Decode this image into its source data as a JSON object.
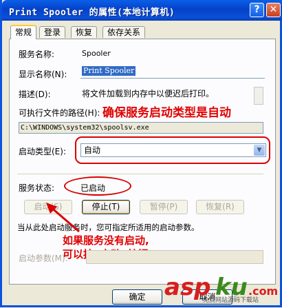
{
  "window": {
    "title": "Print Spooler 的属性(本地计算机)",
    "help_label": "?",
    "close_label": "✕"
  },
  "tabs": [
    "常规",
    "登录",
    "恢复",
    "依存关系"
  ],
  "fields": {
    "service_name_label": "服务名称:",
    "service_name_value": "Spooler",
    "display_name_label": "显示名称(N):",
    "display_name_value": "Print Spooler",
    "description_label": "描述(D):",
    "description_value": "将文件加载到内存中以便迟后打印。",
    "exe_path_label": "可执行文件的路径(H):",
    "exe_path_value": "C:\\WINDOWS\\system32\\spoolsv.exe",
    "startup_type_label": "启动类型(E):",
    "startup_type_value": "自动",
    "status_label": "服务状态:",
    "status_value": "已启动"
  },
  "buttons": {
    "start": "启动(S)",
    "stop": "停止(T)",
    "pause": "暂停(P)",
    "resume": "恢复(R)"
  },
  "info_text": "当从此处启动服务时，您可指定所适用的启动参数。",
  "params_label": "启动参数(M):",
  "params_value": "",
  "annotations": {
    "startup_note": "确保服务启动类型是自动",
    "start_note_line1": "如果服务没有启动,",
    "start_note_line2": "可以按“启动”按钮"
  },
  "footer": {
    "ok": "确定",
    "cancel": "取消"
  },
  "watermark": {
    "brand": "aspku",
    "tld": ".com",
    "tagline": "免费网站源码下载站"
  },
  "colors": {
    "accent_red": "#E00000",
    "selection_blue": "#316AC5",
    "title_blue": "#0542C8",
    "watermark_green": "#3A8A1E",
    "watermark_red": "#D81E1E"
  }
}
